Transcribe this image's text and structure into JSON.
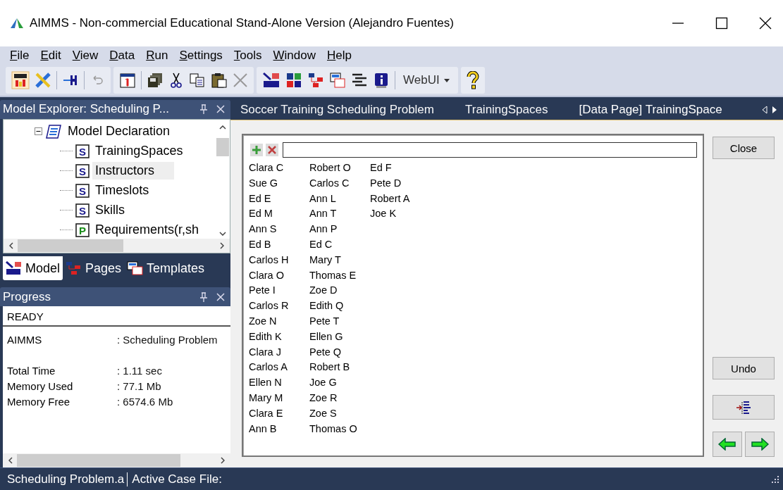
{
  "window": {
    "title": "AIMMS - Non-commercial Educational Stand-Alone Version (Alejandro Fuentes)"
  },
  "menu": [
    "File",
    "Edit",
    "View",
    "Data",
    "Run",
    "Settings",
    "Tools",
    "Window",
    "Help"
  ],
  "toolbar": {
    "dropdown": "WebUI"
  },
  "model_explorer": {
    "title": "Model Explorer: Scheduling P...",
    "tree": [
      {
        "label": "Model Declaration",
        "expanded": true,
        "children": [
          {
            "label": "TrainingSpaces",
            "icon_letter": "S",
            "kind": "set",
            "selected": false
          },
          {
            "label": "Instructors",
            "icon_letter": "S",
            "kind": "set",
            "selected": true
          },
          {
            "label": "Timeslots",
            "icon_letter": "S",
            "kind": "set",
            "selected": false
          },
          {
            "label": "Skills",
            "icon_letter": "S",
            "kind": "set",
            "selected": false
          },
          {
            "label": "Requirements(r,sh",
            "icon_letter": "P",
            "kind": "parameter",
            "selected": false
          }
        ]
      }
    ],
    "tabs": [
      {
        "label": "Model",
        "selected": true
      },
      {
        "label": "Pages",
        "selected": false
      },
      {
        "label": "Templates",
        "selected": false
      }
    ]
  },
  "progress": {
    "title": "Progress",
    "status": "READY",
    "rows": [
      {
        "label": "AIMMS",
        "value": ": Scheduling Problem"
      },
      {
        "label": "Total Time",
        "value": ": 1.11 sec"
      },
      {
        "label": "Memory Used",
        "value": ": 77.1 Mb"
      },
      {
        "label": "Memory Free",
        "value": ": 6574.6 Mb"
      }
    ]
  },
  "document_tabs": [
    {
      "label": "Soccer Training Scheduling Problem"
    },
    {
      "label": "TrainingSpaces"
    },
    {
      "label": "[Data Page] TrainingSpace"
    }
  ],
  "set_editor": {
    "names": [
      "Clara C",
      "Sue G",
      "Ed E",
      "Ed M",
      "Ann S",
      "Ed B",
      "Carlos H",
      "Clara O",
      "Pete I",
      "Carlos R",
      "Zoe N",
      "Edith K",
      "Clara J",
      "Carlos A",
      "Ellen N",
      "Mary M",
      "Clara E",
      "Ann B",
      "Robert O",
      "Carlos C",
      "Ann L",
      "Ann T",
      "Ann P",
      "Ed C",
      "Mary T",
      "Thomas E",
      "Zoe D",
      "Edith Q",
      "Pete T",
      "Ellen G",
      "Pete Q",
      "Robert B",
      "Joe G",
      "Zoe R",
      "Zoe S",
      "Thomas O",
      "Ed F",
      "Pete D",
      "Robert A",
      "Joe K"
    ]
  },
  "buttons": {
    "close": "Close",
    "undo": "Undo"
  },
  "status_bar": [
    "Scheduling Problem.a",
    "Active Case File:"
  ]
}
